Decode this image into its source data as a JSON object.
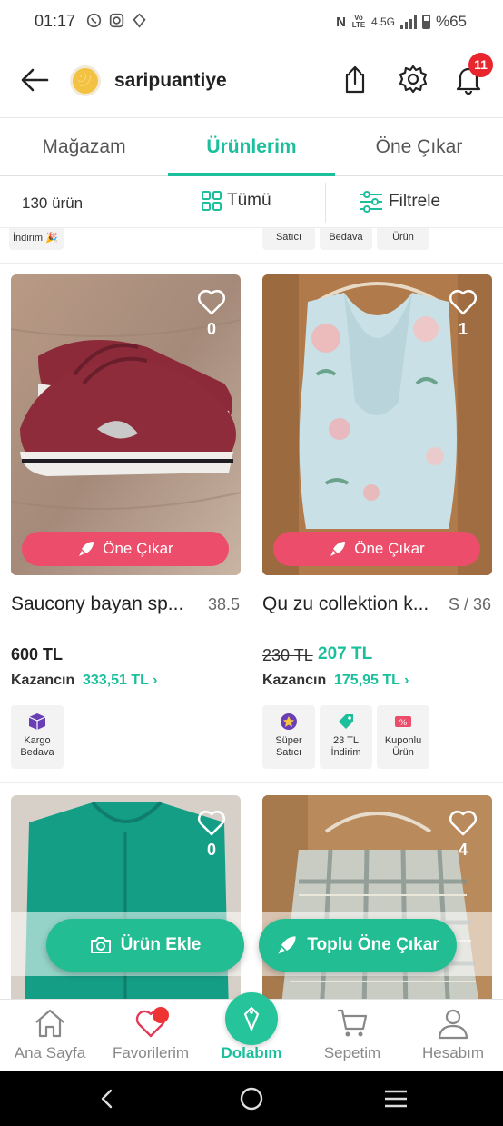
{
  "status_bar": {
    "time": "01:17",
    "network": "4.5G",
    "lte_label": "Vo LTE",
    "battery": "%65"
  },
  "header": {
    "shop_name": "saripuantiye",
    "notification_count": "11"
  },
  "tabs": [
    {
      "label": "Mağazam",
      "active": false
    },
    {
      "label": "Ürünlerim",
      "active": true
    },
    {
      "label": "Öne Çıkar",
      "active": false
    }
  ],
  "filterbar": {
    "count": "130 ürün",
    "all_label": "Tümü",
    "filter_label": "Filtrele"
  },
  "partial_row": {
    "left_badge": "İndirim 🎉",
    "right_badges": [
      "Satıcı",
      "Bedava",
      "Ürün"
    ]
  },
  "products": [
    {
      "title": "Saucony bayan sp...",
      "size": "38.5",
      "likes": "0",
      "price": "600 TL",
      "old_price": "",
      "new_price": "",
      "earn_label": "Kazancın",
      "earn_value": "333,51 TL",
      "promote_label": "Öne Çıkar",
      "badges": [
        {
          "label": "Kargo Bedava",
          "icon": "box-icon",
          "color": "#6a3fb5"
        }
      ]
    },
    {
      "title": "Qu zu collektion k...",
      "size": "S / 36",
      "likes": "1",
      "price": "",
      "old_price": "230 TL",
      "new_price": "207 TL",
      "earn_label": "Kazancın",
      "earn_value": "175,95 TL",
      "promote_label": "Öne Çıkar",
      "badges": [
        {
          "label": "Süper Satıcı",
          "icon": "medal-icon",
          "color": "#6a3fb5"
        },
        {
          "label": "23 TL İndirim",
          "icon": "tag-icon",
          "color": "#1bbf9c"
        },
        {
          "label": "Kuponlu Ürün",
          "icon": "coupon-icon",
          "color": "#ec4d6b"
        }
      ]
    },
    {
      "likes": "0"
    },
    {
      "likes": "4"
    }
  ],
  "fabs": {
    "add_product": "Ürün Ekle",
    "bulk_promote": "Toplu Öne Çıkar"
  },
  "bottom_nav": [
    {
      "label": "Ana Sayfa",
      "icon": "home-icon"
    },
    {
      "label": "Favorilerim",
      "icon": "heart-icon"
    },
    {
      "label": "Dolabım",
      "icon": "hanger-icon",
      "active": true
    },
    {
      "label": "Sepetim",
      "icon": "cart-icon"
    },
    {
      "label": "Hesabım",
      "icon": "user-icon"
    }
  ],
  "colors": {
    "accent": "#1bbf9c",
    "promote": "#ec4d6b",
    "badge_red": "#e8262e"
  }
}
